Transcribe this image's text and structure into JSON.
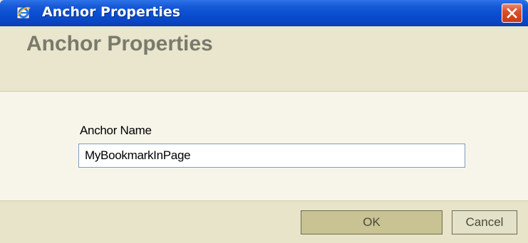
{
  "window": {
    "title": "Anchor Properties",
    "app_icon": "internet-explorer-icon",
    "close_icon": "close-icon"
  },
  "dialog": {
    "heading": "Anchor Properties",
    "field_label": "Anchor Name",
    "field_value": "MyBookmarkInPage"
  },
  "buttons": {
    "ok_label": "OK",
    "cancel_label": "Cancel"
  },
  "colors": {
    "titlebar": "#0a4ed0",
    "close_button": "#d9502b",
    "header_bg": "#e9e6cd",
    "body_bg": "#f7f5ea",
    "footer_bg": "#e7e4c9",
    "ok_button_bg": "#c9c292",
    "heading_text": "#7a7a6c"
  }
}
